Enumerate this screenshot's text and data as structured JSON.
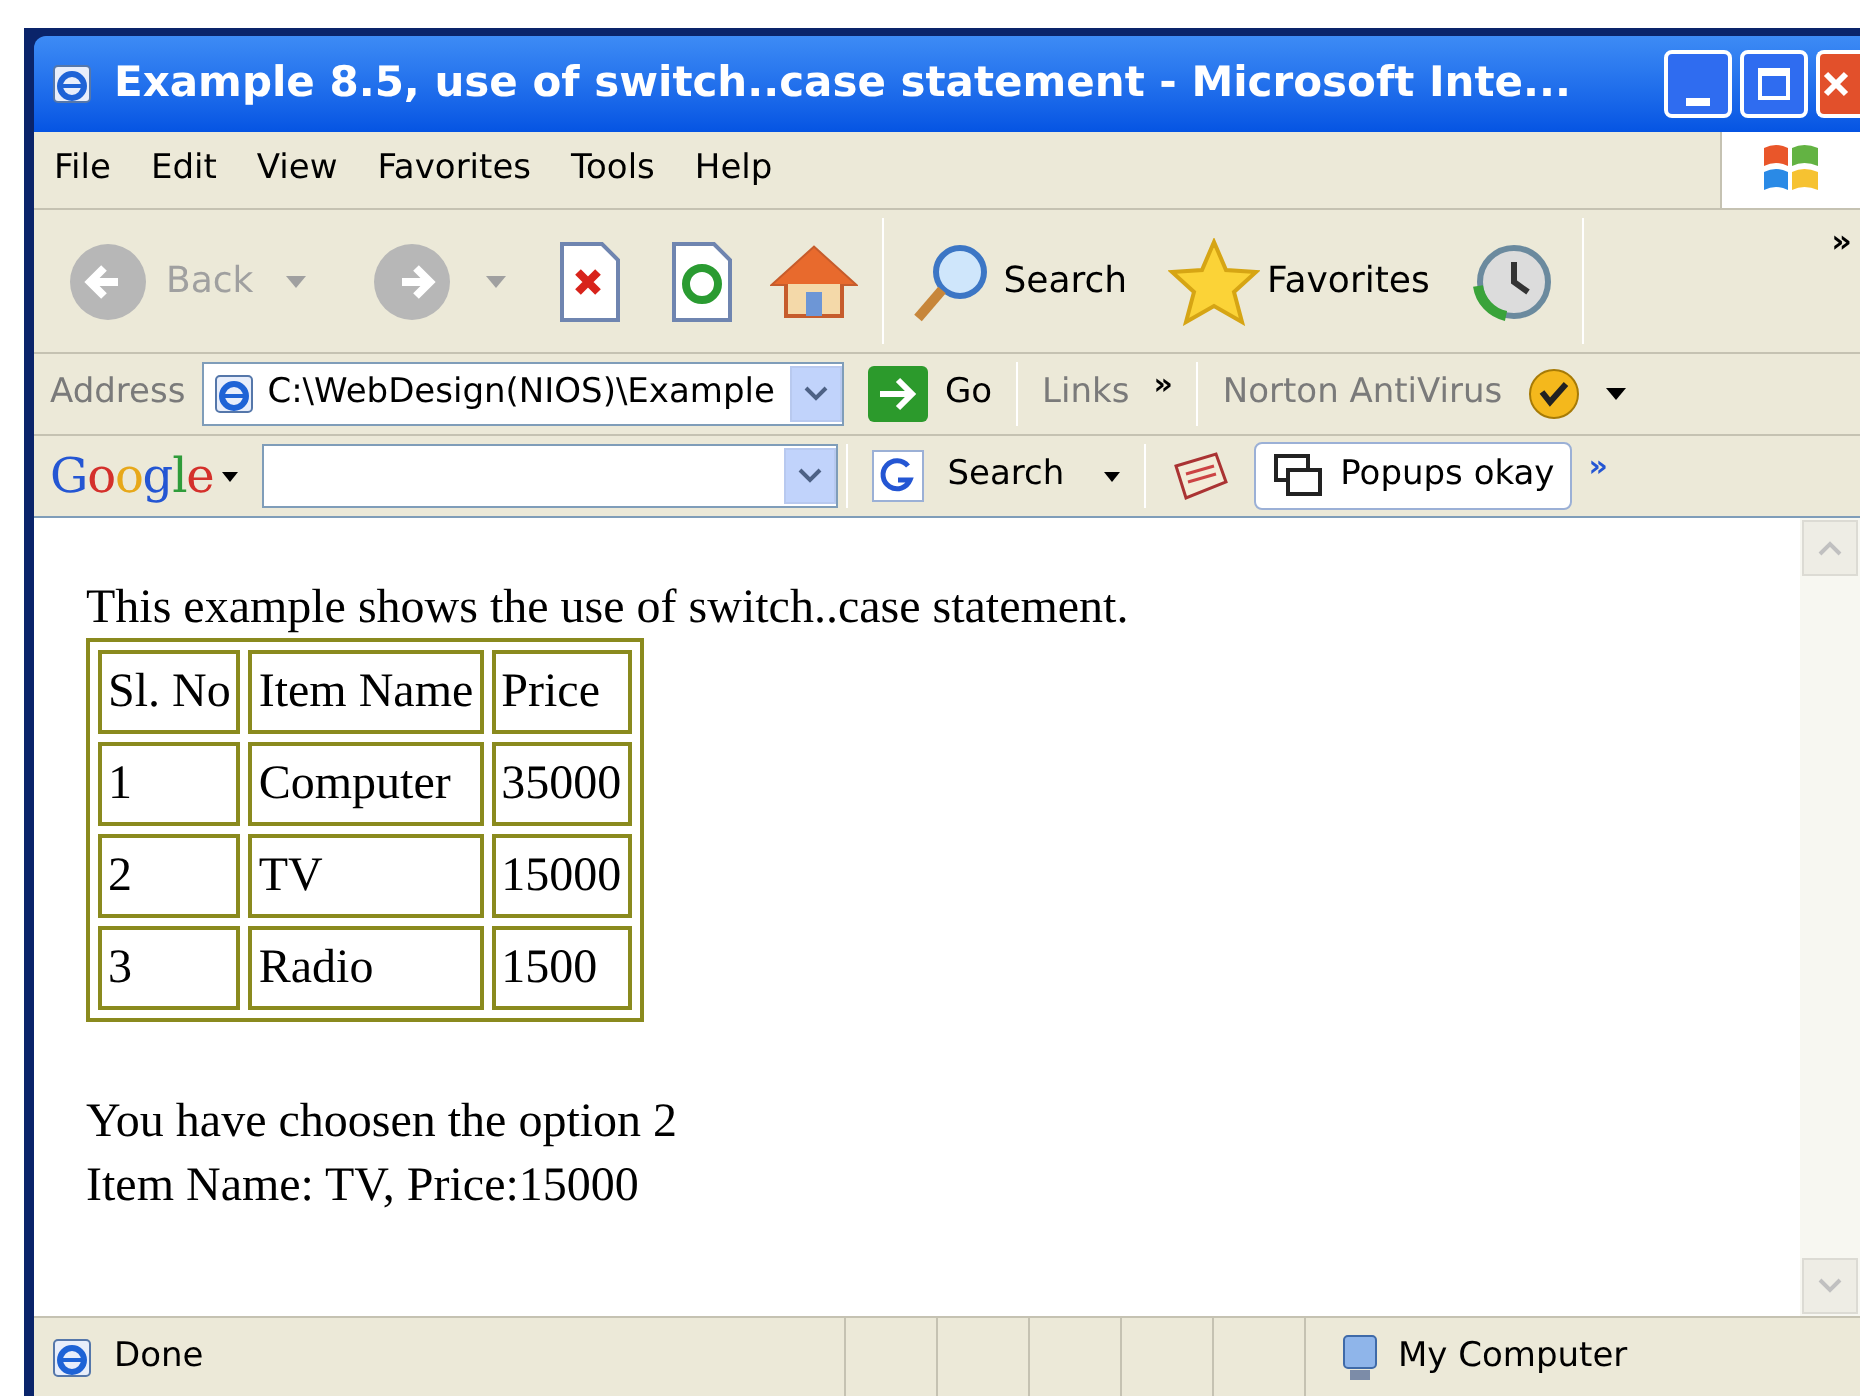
{
  "window": {
    "title": "Example 8.5, use of switch..case statement - Microsoft Inte..."
  },
  "menu": [
    "File",
    "Edit",
    "View",
    "Favorites",
    "Tools",
    "Help"
  ],
  "toolbar": {
    "back": {
      "label": "Back",
      "disabled": true
    },
    "forward": {
      "disabled": true
    },
    "search": "Search",
    "favorites": "Favorites",
    "overflow": "»"
  },
  "address_bar": {
    "label": "Address",
    "value": "C:\\WebDesign(NIOS)\\Example",
    "go": "Go",
    "links": "Links",
    "links_overflow": "»",
    "norton": "Norton AntiVirus"
  },
  "google_bar": {
    "logo": "Google",
    "search": "Search",
    "popups": "Popups okay",
    "overflow": "»"
  },
  "page": {
    "intro": "This example shows the use of switch..case statement.",
    "table": {
      "columns": [
        "Sl. No",
        "Item Name",
        "Price"
      ],
      "rows": [
        [
          "1",
          "Computer",
          "35000"
        ],
        [
          "2",
          "TV",
          "15000"
        ],
        [
          "3",
          "Radio",
          "1500"
        ]
      ]
    },
    "result_lines": [
      "You have choosen the option 2",
      "Item Name: TV, Price:15000"
    ]
  },
  "status_bar": {
    "text": "Done",
    "zone": "My Computer"
  }
}
